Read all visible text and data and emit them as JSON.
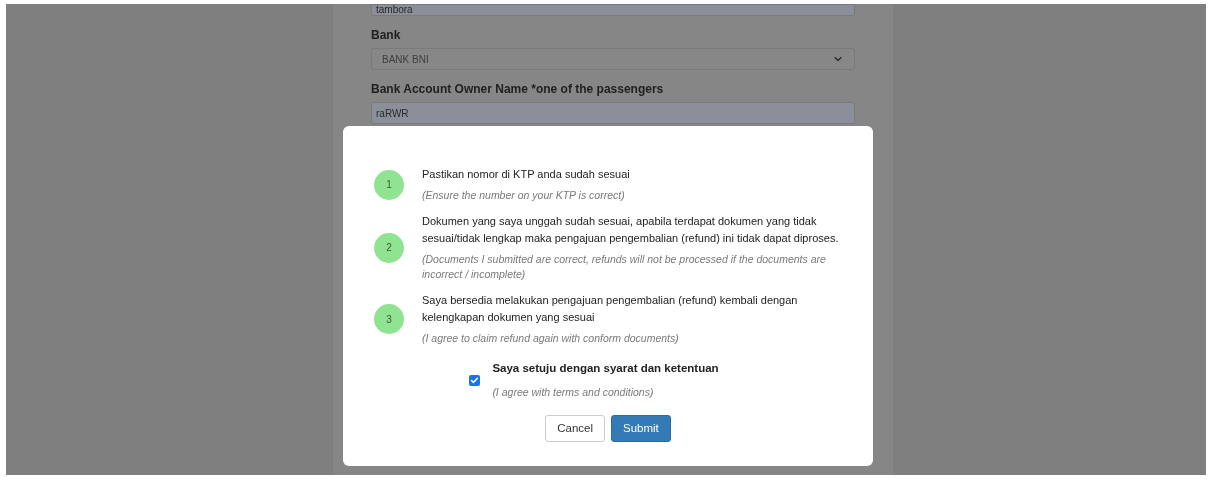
{
  "form": {
    "fields": [
      {
        "kind": "input",
        "value": "tambora"
      },
      {
        "kind": "select",
        "label": "Bank",
        "value": "BANK BNI"
      },
      {
        "kind": "input",
        "label": "Bank Account Owner Name *one of the passengers",
        "value": "raRWR"
      }
    ]
  },
  "modal": {
    "terms": [
      {
        "number": "1",
        "text": "Pastikan nomor di KTP anda sudah sesuai",
        "translation": "(Ensure the number on your KTP is correct)"
      },
      {
        "number": "2",
        "text": "Dokumen yang saya unggah sudah sesuai, apabila terdapat dokumen yang tidak sesuai/tidak lengkap maka pengajuan pengembalian (refund) ini tidak dapat diproses.",
        "translation": "(Documents I submitted are correct, refunds will not be processed if the documents are incorrect / incomplete)"
      },
      {
        "number": "3",
        "text": "Saya bersedia melakukan pengajuan pengembalian (refund) kembali dengan kelengkapan dokumen yang sesuai",
        "translation": "(I agree to claim refund again with conform documents)"
      }
    ],
    "agreement": {
      "checked": true,
      "text": "Saya setuju dengan syarat dan ketentuan",
      "translation": "(I agree with terms and conditions)"
    },
    "buttons": [
      {
        "kind": "secondary",
        "label": "Cancel"
      },
      {
        "kind": "primary",
        "label": "Submit"
      }
    ]
  }
}
